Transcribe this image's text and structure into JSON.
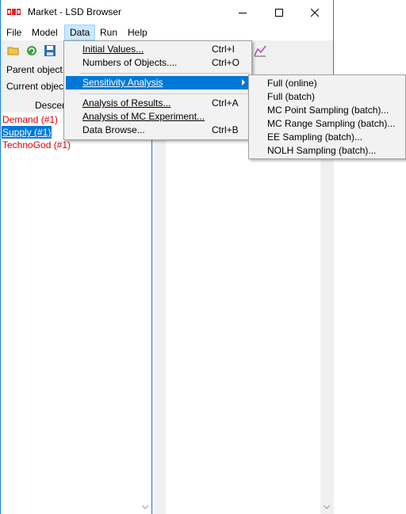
{
  "window": {
    "title": "Market - LSD Browser"
  },
  "menubar": {
    "file": "File",
    "model": "Model",
    "data": "Data",
    "run": "Run",
    "help": "Help"
  },
  "labels": {
    "parent": "Parent object:",
    "current": "Current object",
    "descendants": "Descen"
  },
  "objects": [
    "Demand (#1)",
    "Supply (#1)",
    "TechnoGod (#1)"
  ],
  "data_menu": {
    "initial_values": "Initial Values...",
    "initial_values_acc": "Ctrl+I",
    "numbers_of_objects": "Numbers of Objects....",
    "numbers_of_objects_acc": "Ctrl+O",
    "sensitivity_analysis": "Sensitivity Analysis",
    "analysis_of_results": "Analysis of Results...",
    "analysis_of_results_acc": "Ctrl+A",
    "analysis_mc": "Analysis of MC Experiment...",
    "data_browse": "Data Browse...",
    "data_browse_acc": "Ctrl+B"
  },
  "sa_menu": {
    "full_online": "Full (online)",
    "full_batch": "Full (batch)",
    "mc_point": "MC Point Sampling (batch)...",
    "mc_range": "MC Range Sampling (batch)...",
    "ee_sampling": "EE Sampling (batch)...",
    "nolh_sampling": "NOLH Sampling (batch)..."
  },
  "colors": {
    "accent": "#0078d7",
    "object_text": "#d40000",
    "menu_bg": "#f2f2f2"
  }
}
